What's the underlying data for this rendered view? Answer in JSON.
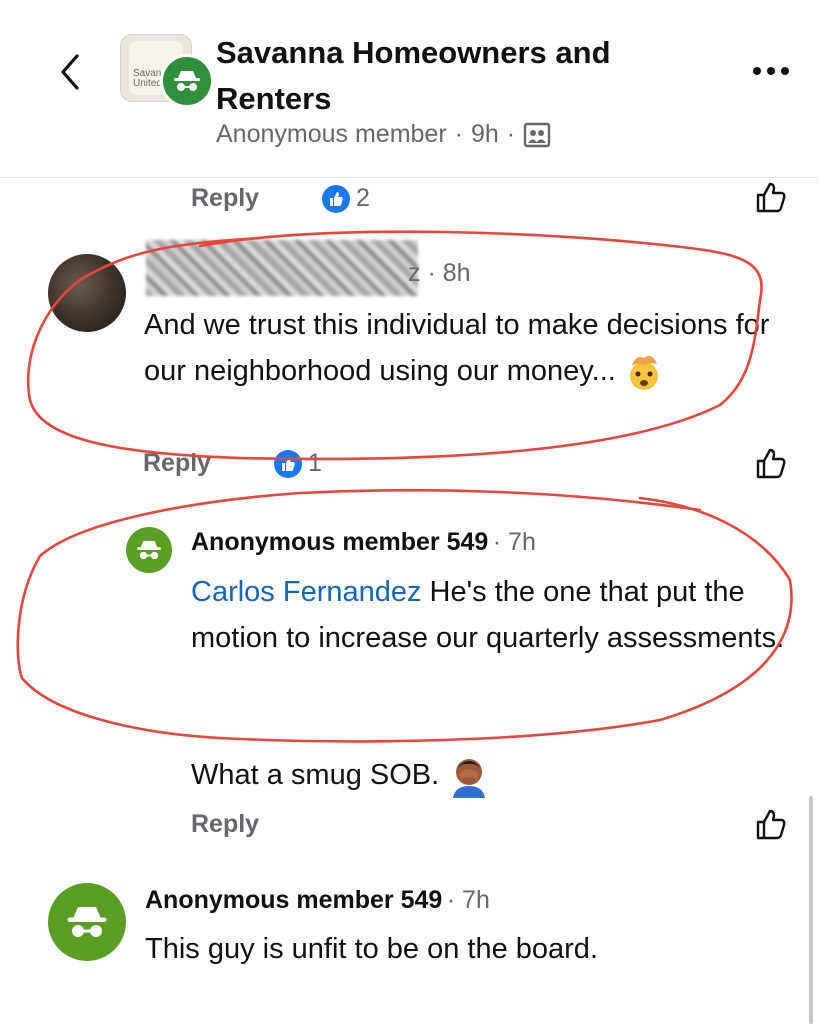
{
  "header": {
    "group_name": "Savanna Homeowners and Renters",
    "group_thumb_text": "Savanna United",
    "subtitle_author": "Anonymous member",
    "subtitle_time": "9h",
    "separator": "·"
  },
  "comments": [
    {
      "reply_label": "Reply",
      "like_count": "2"
    },
    {
      "author_suffix": "z",
      "time": "· 8h",
      "text": "And we trust this individual to make decisions for our neighborhood using our money...",
      "emoji": "exploding-head",
      "reply_label": "Reply",
      "like_count": "1"
    },
    {
      "author": "Anonymous member 549",
      "time": "· 7h",
      "mention": "Carlos Fernandez",
      "text": " He's the one that put the motion to increase our quarterly assessments.",
      "text2": "What a smug SOB.",
      "emoji": "face-palm",
      "reply_label": "Reply"
    },
    {
      "author": "Anonymous member 549",
      "time": "· 7h",
      "text": "This guy is unfit to be on the board."
    }
  ],
  "icons": {
    "back": "chevron-left-icon",
    "more": "more-horizontal-icon",
    "privacy": "members-only-icon",
    "like": "thumbs-up-icon",
    "anonymous": "incognito-icon"
  },
  "colors": {
    "annotation": "#e8453c",
    "like_blue": "#1877f2",
    "anon_green": "#5a9e23",
    "mention": "#1565c0"
  }
}
